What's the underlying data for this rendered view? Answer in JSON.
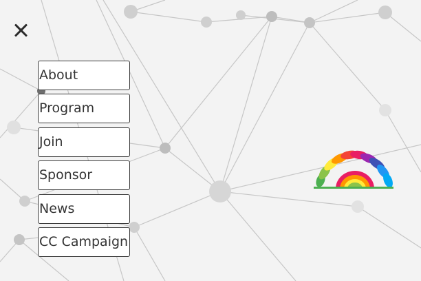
{
  "close_icon": "close-icon",
  "menu": {
    "items": [
      {
        "label": "About"
      },
      {
        "label": "Program"
      },
      {
        "label": "Join"
      },
      {
        "label": "Sponsor"
      },
      {
        "label": "News"
      },
      {
        "label": "CC Campaign"
      }
    ]
  },
  "logo": {
    "icon": "rainbow-fan-logo",
    "colors": [
      "#4caf50",
      "#8bc34a",
      "#ffeb3b",
      "#ff9800",
      "#f44336",
      "#e91e63",
      "#9c27b0",
      "#3f51b5",
      "#2196f3",
      "#03a9f4"
    ]
  },
  "theme": {
    "background": "#f3f3f3",
    "network_line": "#c2c2c2",
    "button_border": "#3a3a3a"
  }
}
